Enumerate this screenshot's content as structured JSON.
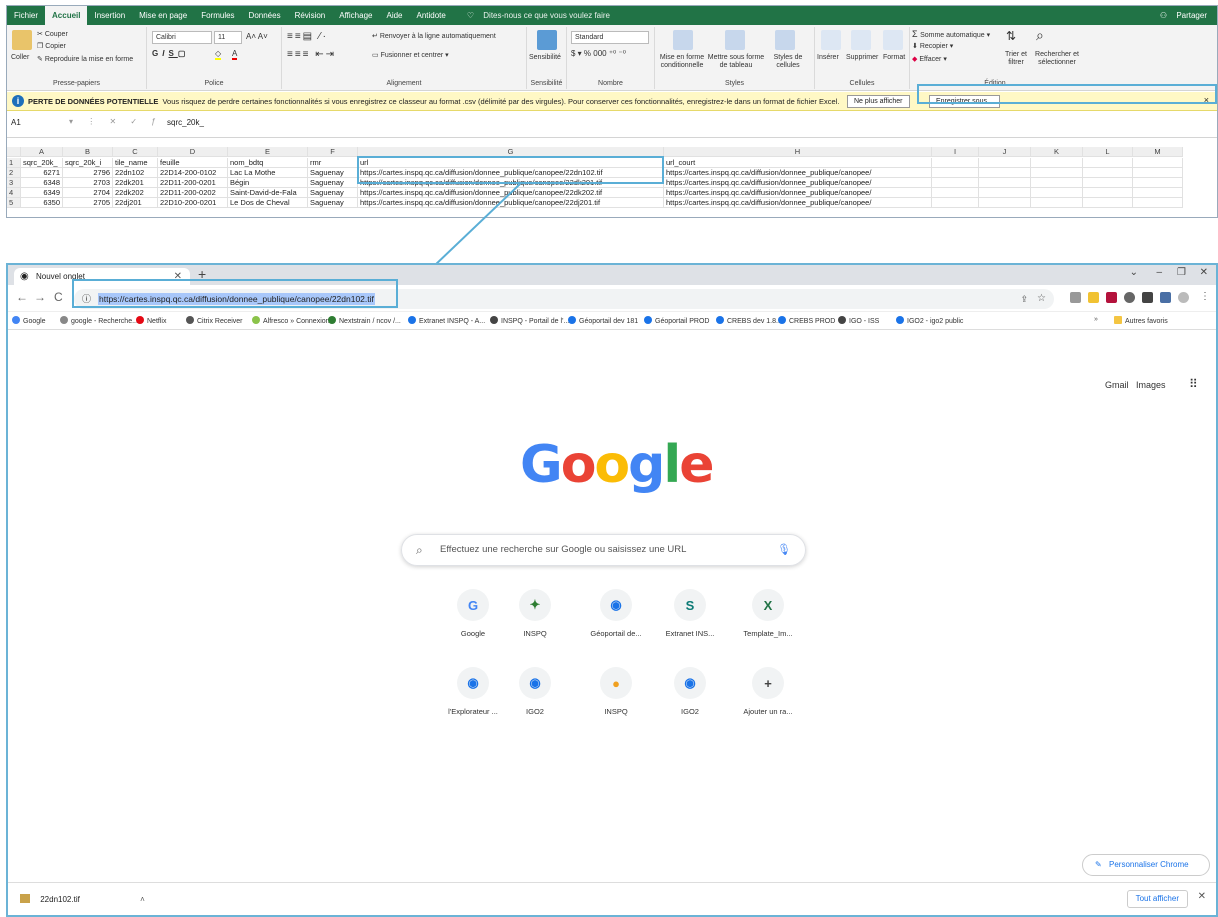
{
  "excel": {
    "tabs": [
      "Fichier",
      "Accueil",
      "Insertion",
      "Mise en page",
      "Formules",
      "Données",
      "Révision",
      "Affichage",
      "Aide",
      "Antidote"
    ],
    "active_tab": "Accueil",
    "tell_me": "Dites-nous ce que vous voulez faire",
    "share": "Partager",
    "clipboard": {
      "paste": "Coller",
      "cut": "Couper",
      "copy": "Copier",
      "format_painter": "Reproduire la mise en forme",
      "group": "Presse-papiers"
    },
    "font": {
      "name": "Calibri",
      "size": "11",
      "group": "Police"
    },
    "alignment": {
      "wrap": "Renvoyer à la ligne automatiquement",
      "merge": "Fusionner et centrer",
      "group": "Alignement"
    },
    "sensitivity": {
      "label": "Sensibilité",
      "group": "Sensibilité"
    },
    "number": {
      "format": "Standard",
      "group": "Nombre"
    },
    "styles": {
      "conditional": "Mise en forme conditionnelle",
      "table": "Mettre sous forme de tableau",
      "cell_styles": "Styles de cellules",
      "group": "Styles"
    },
    "cells": {
      "insert": "Insérer",
      "delete": "Supprimer",
      "format": "Format",
      "group": "Cellules"
    },
    "editing": {
      "autosum": "Somme automatique",
      "fill": "Recopier",
      "clear": "Effacer",
      "sort": "Trier et filtrer",
      "find": "Rechercher et sélectionner",
      "group": "Édition"
    },
    "warning": {
      "title": "PERTE DE DONNÉES POTENTIELLE",
      "message": "Vous risquez de perdre certaines fonctionnalités si vous enregistrez ce classeur au format .csv (délimité par des virgules). Pour conserver ces fonctionnalités, enregistrez-le dans un format de fichier Excel.",
      "dont_show": "Ne plus afficher",
      "save_as": "Enregistrer sous..."
    },
    "namebox": "A1",
    "formula": "sqrc_20k_",
    "columns": [
      "A",
      "B",
      "C",
      "D",
      "E",
      "F",
      "G",
      "H",
      "I",
      "J",
      "K",
      "L",
      "M"
    ],
    "rows": [
      {
        "n": "1",
        "cells": [
          "sqrc_20k_",
          "sqrc_20k_i",
          "tile_name",
          "feuille",
          "nom_bdtq",
          "rmr",
          "url",
          "url_court"
        ]
      },
      {
        "n": "2",
        "cells": [
          "6271",
          "2796",
          "22dn102",
          "22D14-200-0102",
          "Lac La Mothe",
          "Saguenay",
          "https://cartes.inspq.qc.ca/diffusion/donnee_publique/canopee/22dn102.tif",
          "https://cartes.inspq.qc.ca/diffusion/donnee_publique/canopee/"
        ]
      },
      {
        "n": "3",
        "cells": [
          "6348",
          "2703",
          "22dk201",
          "22D11-200-0201",
          "Bégin",
          "Saguenay",
          "https://cartes.inspq.qc.ca/diffusion/donnee_publique/canopee/22dk201.tif",
          "https://cartes.inspq.qc.ca/diffusion/donnee_publique/canopee/"
        ]
      },
      {
        "n": "4",
        "cells": [
          "6349",
          "2704",
          "22dk202",
          "22D11-200-0202",
          "Saint-David-de-Fala",
          "Saguenay",
          "https://cartes.inspq.qc.ca/diffusion/donnee_publique/canopee/22dk202.tif",
          "https://cartes.inspq.qc.ca/diffusion/donnee_publique/canopee/"
        ]
      },
      {
        "n": "5",
        "cells": [
          "6350",
          "2705",
          "22dj201",
          "22D10-200-0201",
          "Le Dos de Cheval",
          "Saguenay",
          "https://cartes.inspq.qc.ca/diffusion/donnee_publique/canopee/22dj201.tif",
          "https://cartes.inspq.qc.ca/diffusion/donnee_publique/canopee/"
        ]
      }
    ]
  },
  "chrome": {
    "tab_title": "Nouvel onglet",
    "url": "https://cartes.inspq.qc.ca/diffusion/donnee_publique/canopee/22dn102.tif",
    "bookmarks": [
      "Google",
      "google - Recherche...",
      "Netflix",
      "Citrix Receiver",
      "Alfresco » Connexion",
      "Nextstrain / ncov /...",
      "Extranet INSPQ - A...",
      "INSPQ - Portail de l'...",
      "Géoportail dev 181",
      "Géoportail PROD",
      "CREBS dev 1.8.1",
      "CREBS PROD",
      "IGO - ISS",
      "IGO2 - igo2 public"
    ],
    "other_bookmarks": "Autres favoris",
    "gmail": "Gmail",
    "images": "Images",
    "search_placeholder": "Effectuez une recherche sur Google ou saisissez une URL",
    "shortcuts": [
      {
        "label": "Google",
        "icon": "G"
      },
      {
        "label": "INSPQ",
        "icon": "✦"
      },
      {
        "label": "Géoportail de...",
        "icon": "◉"
      },
      {
        "label": "Extranet INS...",
        "icon": "S"
      },
      {
        "label": "Template_Im...",
        "icon": "X"
      },
      {
        "label": "l'Explorateur ...",
        "icon": "◉"
      },
      {
        "label": "IGO2",
        "icon": "◉"
      },
      {
        "label": "INSPQ",
        "icon": "●"
      },
      {
        "label": "IGO2",
        "icon": "◉"
      },
      {
        "label": "Ajouter un ra...",
        "icon": "+"
      }
    ],
    "customize": "Personnaliser Chrome",
    "download_file": "22dn102.tif",
    "show_all": "Tout afficher"
  },
  "colors": {
    "excel_green": "#217346",
    "annotation": "#5aaed6",
    "url_highlight": "#a8c7fa"
  }
}
